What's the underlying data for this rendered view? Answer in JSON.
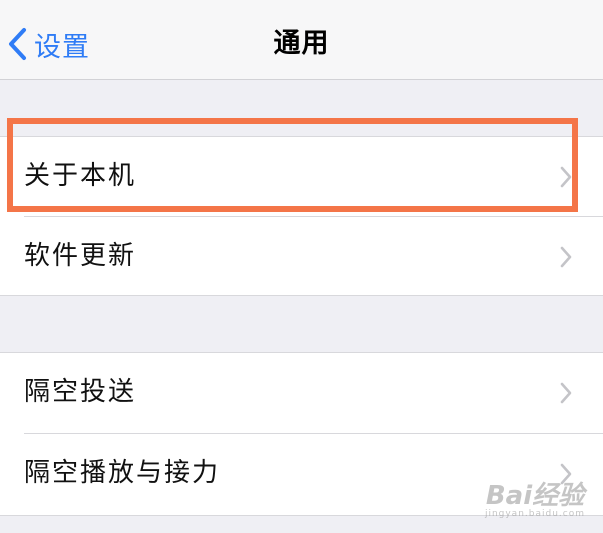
{
  "navbar": {
    "back_label": "设置",
    "title": "通用",
    "accent_color": "#2f7cf6"
  },
  "groups": [
    {
      "rows": [
        {
          "label": "关于本机",
          "highlighted": true
        },
        {
          "label": "软件更新"
        }
      ]
    },
    {
      "rows": [
        {
          "label": "隔空投送"
        },
        {
          "label": "隔空播放与接力"
        }
      ]
    }
  ],
  "highlight_color": "#f47548",
  "watermark": {
    "main": "Bai经验",
    "sub": "jingyan.baidu.com"
  }
}
